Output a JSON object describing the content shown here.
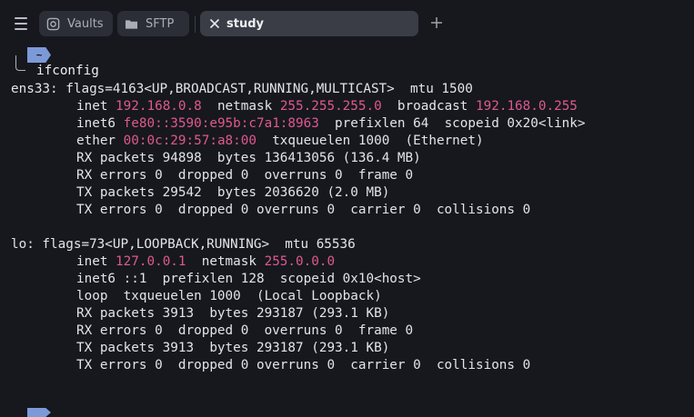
{
  "tabs": [
    {
      "label": "Vaults",
      "icon": "vault-icon"
    },
    {
      "label": "SFTP",
      "icon": "folder-icon"
    },
    {
      "label": "study",
      "icon": "close-icon",
      "active": true
    }
  ],
  "accent": "#7c9ad8",
  "terminal": {
    "prompt_dir": "~",
    "command": "ifconfig",
    "ens33": {
      "header": "ens33: flags=4163<UP,BROADCAST,RUNNING,MULTICAST>  mtu 1500",
      "inet_label": "inet ",
      "inet": "192.168.0.8",
      "netmask_label": "  netmask ",
      "netmask": "255.255.255.0",
      "broadcast_label": "  broadcast ",
      "broadcast": "192.168.0.255",
      "inet6_label": "inet6 ",
      "inet6": "fe80::3590:e95b:c7a1:8963",
      "inet6_rest": "  prefixlen 64  scopeid 0x20<link>",
      "ether_label": "ether ",
      "ether": "00:0c:29:57:a8:00",
      "ether_rest": "  txqueuelen 1000  (Ethernet)",
      "rx_packets": "RX packets 94898  bytes 136413056 (136.4 MB)",
      "rx_errors": "RX errors 0  dropped 0  overruns 0  frame 0",
      "tx_packets": "TX packets 29542  bytes 2036620 (2.0 MB)",
      "tx_errors": "TX errors 0  dropped 0 overruns 0  carrier 0  collisions 0"
    },
    "lo": {
      "header": "lo: flags=73<UP,LOOPBACK,RUNNING>  mtu 65536",
      "inet_label": "inet ",
      "inet": "127.0.0.1",
      "netmask_label": "  netmask ",
      "netmask": "255.0.0.0",
      "inet6_line": "inet6 ::1  prefixlen 128  scopeid 0x10<host>",
      "loop_line": "loop  txqueuelen 1000  (Local Loopback)",
      "rx_packets": "RX packets 3913  bytes 293187 (293.1 KB)",
      "rx_errors": "RX errors 0  dropped 0  overruns 0  frame 0",
      "tx_packets": "TX packets 3913  bytes 293187 (293.1 KB)",
      "tx_errors": "TX errors 0  dropped 0 overruns 0  carrier 0  collisions 0"
    }
  }
}
